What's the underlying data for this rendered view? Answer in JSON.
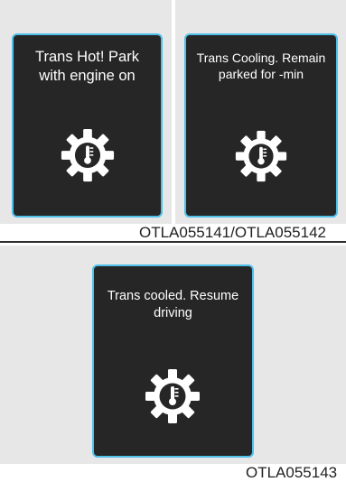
{
  "panels": [
    {
      "message": "Trans Hot! Park\nwith engine on",
      "icon": "transmission-temperature-icon"
    },
    {
      "message": "Trans Cooling. Remain\nparked for -min",
      "icon": "transmission-temperature-icon"
    },
    {
      "message": "Trans cooled. Resume\ndriving",
      "icon": "transmission-temperature-icon"
    }
  ],
  "captions": {
    "top": "OTLA055141/OTLA055142",
    "bottom": "OTLA055143"
  },
  "colors": {
    "panel_bg": "#262626",
    "panel_border": "#4fc0e8",
    "text": "#ffffff",
    "page_bg": "#e7e7e8"
  }
}
